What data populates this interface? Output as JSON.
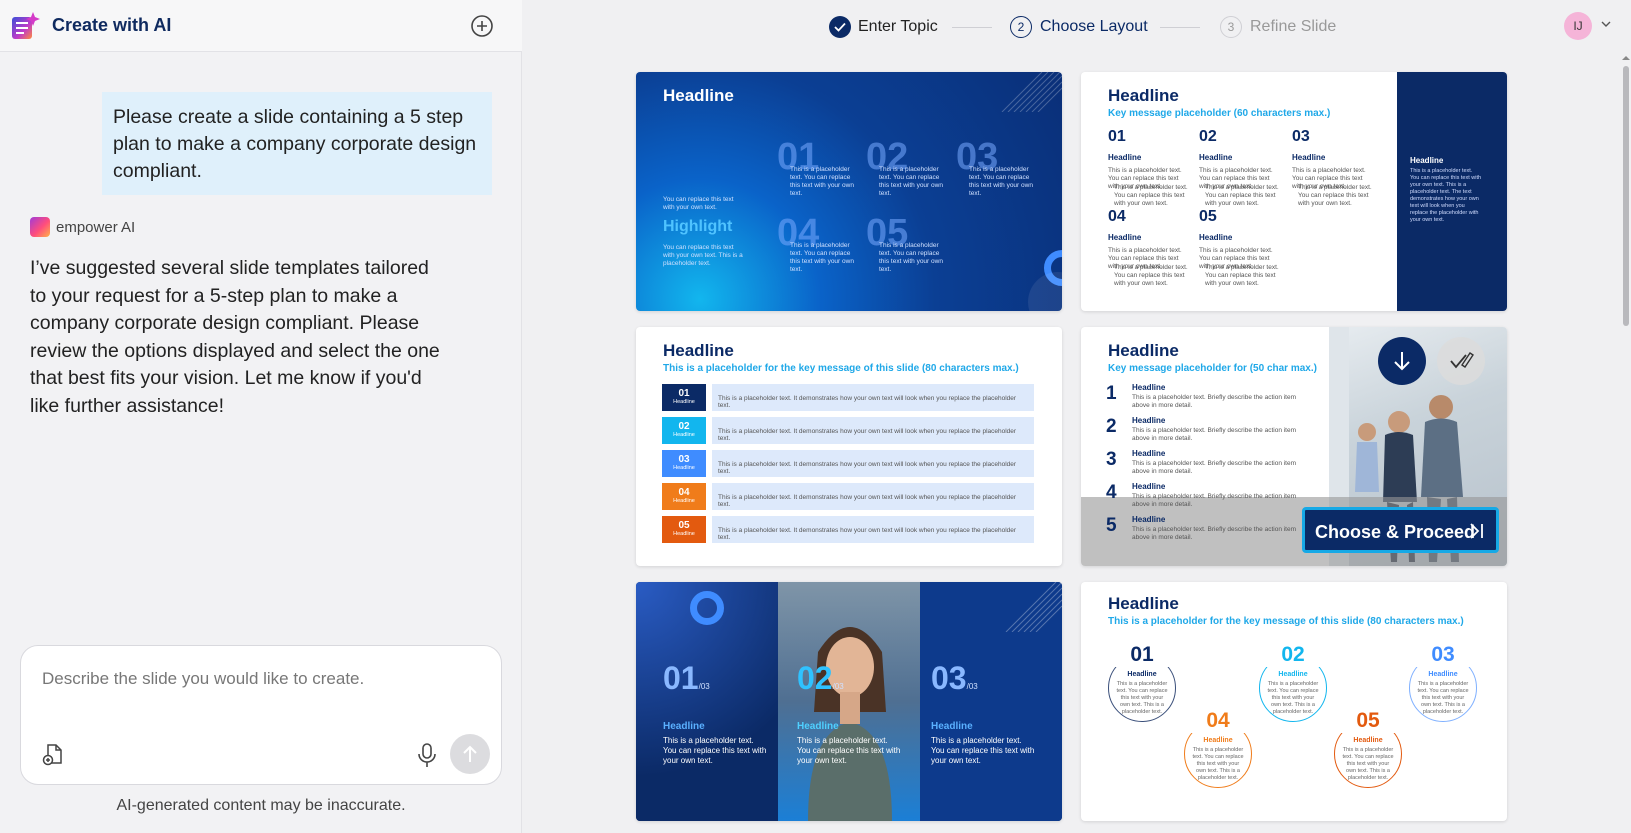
{
  "app": {
    "title": "Create with AI"
  },
  "chat": {
    "user_message": "Please create a slide containing a 5 step plan to make a company corporate design compliant.",
    "ai_name": "empower AI",
    "ai_message": "I’ve suggested several slide templates tailored to your request for a 5-step plan to make a company corporate design compliant. Please review the options displayed and select the one that best fits your vision. Let me know if you'd like further assistance!"
  },
  "composer": {
    "placeholder": "Describe the slide you would like to create."
  },
  "disclaimer": "AI-generated content may be inaccurate.",
  "stepper": {
    "steps": [
      {
        "number": "1",
        "label": "Enter Topic",
        "state": "done"
      },
      {
        "number": "2",
        "label": "Choose Layout",
        "state": "active"
      },
      {
        "number": "3",
        "label": "Refine Slide",
        "state": "pending"
      }
    ]
  },
  "user": {
    "initials": "IJ"
  },
  "colors": {
    "navy": "#0b2a66",
    "cyan": "#16a9e6",
    "orange": "#f07c1a",
    "accent_purple": "#a03bd8"
  },
  "templates": {
    "t1": {
      "headline": "Headline",
      "nums": [
        "01",
        "02",
        "03",
        "04",
        "05"
      ],
      "ph": "This is a placeholder text. You can replace this text with your own text.",
      "left_text": "You can replace this text with your own text.",
      "highlight": "Highlight",
      "left_text2": "You can replace this text with your own text. This is a placeholder text."
    },
    "t2": {
      "headline": "Headline",
      "sub": "Key message placeholder (60 characters max.)",
      "nums": [
        "01",
        "02",
        "03",
        "04",
        "05"
      ],
      "item_headline": "Headline",
      "ph": "This is a placeholder text. You can replace this text with your own text.",
      "bullet1": "This is a placeholder text.",
      "bullet2": "You can replace this text with your own text.",
      "side_headline": "Headline",
      "side_text": "This is a placeholder text. You can replace this text with your own text. This is a placeholder text. The text demonstrates how your own text will look when you replace the placeholder with your own text."
    },
    "t3": {
      "headline": "Headline",
      "sub": "This is a placeholder for the key message of this slide (80 characters max.)",
      "nums": [
        "01",
        "02",
        "03",
        "04",
        "05"
      ],
      "row_label": "Headline",
      "row_text": "This is a placeholder text. It demonstrates how your own text will look when you replace the placeholder text."
    },
    "t4": {
      "headline": "Headline",
      "sub": "Key message placeholder for (50 char max.)",
      "nums": [
        "1",
        "2",
        "3",
        "4",
        "5"
      ],
      "item_headline": "Headline",
      "item_text": "This is a placeholder text. Briefly describe the action item above in more detail.",
      "choose_label": "Choose & Proceed"
    },
    "t5": {
      "nums": [
        "01",
        "02",
        "03"
      ],
      "total": "/03",
      "headline": "Headline",
      "text": "This is a placeholder text. You can replace this text with your own text."
    },
    "t6": {
      "headline": "Headline",
      "sub": "This is a placeholder for the key message of this slide (80 characters max.)",
      "nums": [
        "01",
        "02",
        "03",
        "04",
        "05"
      ],
      "circle_headline": "Headline",
      "circle_text": "This is a placeholder text. You can replace this text with your own text. This is a placeholder text."
    }
  }
}
